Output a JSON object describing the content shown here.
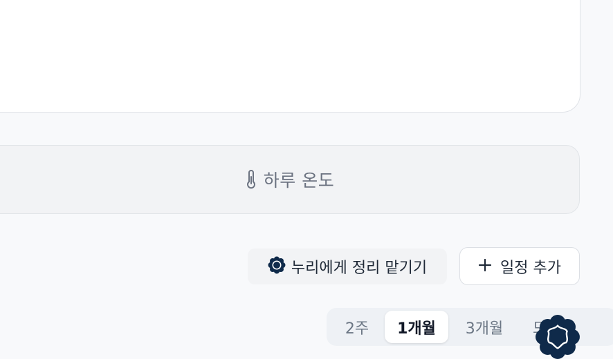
{
  "weather": {
    "label": "하루 온도",
    "icon": "thermometer-icon"
  },
  "actions": {
    "nuri_label": "누리에게 정리 맡기기",
    "nuri_icon": "nuri-flower-icon",
    "add_label": "일정 추가",
    "add_icon": "plus-icon"
  },
  "range_tabs": [
    {
      "label": "2주",
      "active": false
    },
    {
      "label": "1개월",
      "active": true
    },
    {
      "label": "3개월",
      "active": false
    },
    {
      "label": "모",
      "active": false
    }
  ],
  "fab": {
    "icon": "nuri-flower-icon"
  },
  "colors": {
    "brand_navy": "#0f2a4a",
    "background": "#f8f9fb",
    "muted_text": "#6b7280",
    "card_border": "#dfe2e7"
  }
}
